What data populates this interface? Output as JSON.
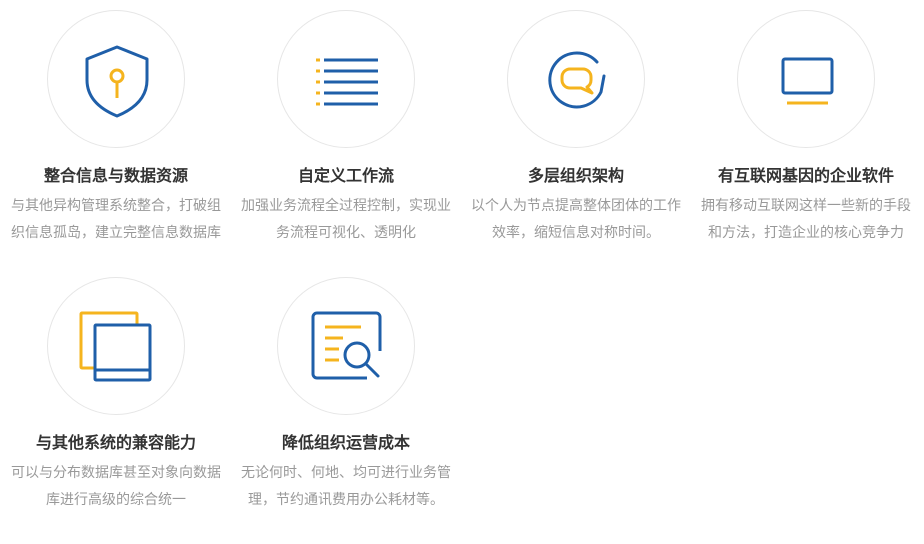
{
  "colors": {
    "primary": "#1f5fa9",
    "accent": "#f5b41e",
    "title": "#333333",
    "text": "#999999",
    "circle_border": "#e6e6e6"
  },
  "features": [
    {
      "icon": "shield-icon",
      "title": "整合信息与数据资源",
      "desc": "与其他异构管理系统整合，打破组织信息孤岛，建立完整信息数据库"
    },
    {
      "icon": "list-icon",
      "title": "自定义工作流",
      "desc": "加强业务流程全过程控制，实现业务流程可视化、透明化"
    },
    {
      "icon": "at-chat-icon",
      "title": "多层组织架构",
      "desc": "以个人为节点提高整体团体的工作效率，缩短信息对称时间。"
    },
    {
      "icon": "monitor-icon",
      "title": "有互联网基因的企业软件",
      "desc": "拥有移动互联网这样一些新的手段和方法，打造企业的核心竞争力"
    },
    {
      "icon": "layers-icon",
      "title": "与其他系统的兼容能力",
      "desc": "可以与分布数据库甚至对象向数据库进行高级的综合统一"
    },
    {
      "icon": "document-search-icon",
      "title": "降低组织运营成本",
      "desc": "无论何时、何地、均可进行业务管理，节约通讯费用办公耗材等。"
    }
  ]
}
